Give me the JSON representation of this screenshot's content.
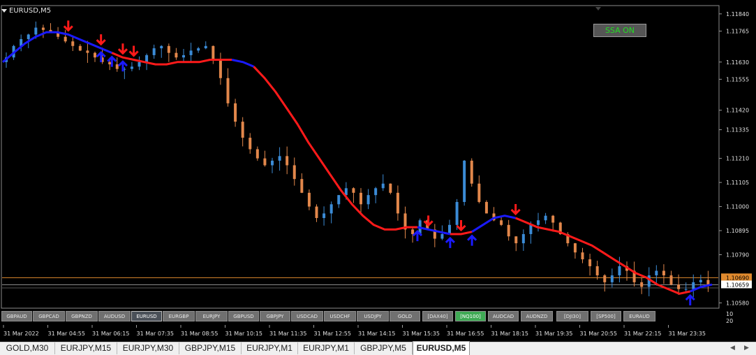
{
  "window": {
    "symbol_title": "EURUSD,M5"
  },
  "ssa_button": {
    "label": "SSA ON"
  },
  "chart_data": {
    "type": "candlestick",
    "symbol": "EURUSD",
    "timeframe": "M5",
    "ylim": [
      1.1056,
      1.1187
    ],
    "y_ticks": [
      "1.11840",
      "1.11765",
      "1.11630",
      "1.11555",
      "1.11420",
      "1.11335",
      "1.11210",
      "1.11105",
      "1.11000",
      "1.10895",
      "1.10790",
      "1.10580"
    ],
    "x_ticks": [
      "31 Mar 2022",
      "31 Mar 04:55",
      "31 Mar 06:15",
      "31 Mar 07:35",
      "31 Mar 08:55",
      "31 Mar 10:15",
      "31 Mar 11:35",
      "31 Mar 12:55",
      "31 Mar 14:15",
      "31 Mar 15:35",
      "31 Mar 16:55",
      "31 Mar 18:15",
      "31 Mar 19:35",
      "31 Mar 20:55",
      "31 Mar 22:15",
      "31 Mar 23:35"
    ],
    "price_labels": {
      "orange": "1.10690",
      "current": "1.10659"
    },
    "orange_line_level": 1.1069,
    "current_price": 1.10659,
    "bottom_scale": [
      "10",
      "20"
    ],
    "closes": [
      1.1165,
      1.117,
      1.1173,
      1.1175,
      1.1178,
      1.1177,
      1.1176,
      1.1174,
      1.1172,
      1.117,
      1.1168,
      1.1167,
      1.1165,
      1.1163,
      1.1162,
      1.116,
      1.116,
      1.1161,
      1.1163,
      1.1166,
      1.1169,
      1.117,
      1.1167,
      1.1165,
      1.1166,
      1.1168,
      1.1169,
      1.117,
      1.1164,
      1.1156,
      1.1145,
      1.1137,
      1.113,
      1.1125,
      1.1121,
      1.1118,
      1.112,
      1.1122,
      1.1118,
      1.1112,
      1.1106,
      1.11,
      1.1095,
      1.1097,
      1.1101,
      1.1105,
      1.1108,
      1.1106,
      1.1101,
      1.1105,
      1.1108,
      1.111,
      1.1106,
      1.1097,
      1.109,
      1.1088,
      1.1094,
      1.109,
      1.1086,
      1.1088,
      1.1092,
      1.1102,
      1.112,
      1.111,
      1.1102,
      1.1097,
      1.1094,
      1.1092,
      1.1087,
      1.1084,
      1.1088,
      1.1092,
      1.1094,
      1.1096,
      1.1093,
      1.1088,
      1.1084,
      1.108,
      1.1077,
      1.1074,
      1.107,
      1.1067,
      1.107,
      1.1074,
      1.1072,
      1.1067,
      1.1065,
      1.107,
      1.1072,
      1.107,
      1.1066,
      1.1064,
      1.1064,
      1.1067,
      1.1068,
      1.1066
    ],
    "ssa_line": [
      1.1163,
      1.1167,
      1.1171,
      1.1174,
      1.1176,
      1.1176,
      1.1175,
      1.1173,
      1.1171,
      1.1169,
      1.1167,
      1.1165,
      1.1164,
      1.1163,
      1.1162,
      1.1162,
      1.1163,
      1.1163,
      1.1163,
      1.1164,
      1.1164,
      1.1164,
      1.1163,
      1.1161,
      1.1156,
      1.115,
      1.1143,
      1.1136,
      1.1128,
      1.1121,
      1.1114,
      1.1107,
      1.1101,
      1.1096,
      1.1092,
      1.109,
      1.109,
      1.1091,
      1.1091,
      1.109,
      1.1089,
      1.1088,
      1.1088,
      1.1089,
      1.1092,
      1.1095,
      1.1096,
      1.1095,
      1.1093,
      1.1091,
      1.109,
      1.1089,
      1.1087,
      1.1085,
      1.1083,
      1.108,
      1.1077,
      1.1074,
      1.1071,
      1.1069,
      1.1066,
      1.1064,
      1.1062,
      1.1063,
      1.1065,
      1.1066
    ],
    "ssa_segments": [
      {
        "from": 0,
        "to": 10,
        "color": "#1a1aff"
      },
      {
        "from": 10,
        "to": 21,
        "color": "#ff1a1a"
      },
      {
        "from": 21,
        "to": 23,
        "color": "#1a1aff"
      },
      {
        "from": 23,
        "to": 38,
        "color": "#ff1a1a"
      },
      {
        "from": 38,
        "to": 41,
        "color": "#1a1aff"
      },
      {
        "from": 41,
        "to": 43,
        "color": "#ff1a1a"
      },
      {
        "from": 43,
        "to": 47,
        "color": "#1a1aff"
      },
      {
        "from": 47,
        "to": 63,
        "color": "#ff1a1a"
      },
      {
        "from": 63,
        "to": 65,
        "color": "#1a1aff"
      }
    ],
    "up_arrows": [
      9,
      10,
      11,
      38,
      41,
      43,
      63
    ],
    "down_arrows": [
      6,
      9,
      11,
      12,
      39,
      42,
      47
    ],
    "colors": {
      "bull": "#3b8bd6",
      "bear": "#e2874b",
      "grid": "#2a2a2a",
      "axis": "#9a9a9a",
      "orange_line": "#e08a2e",
      "current_line": "#8a8a8a"
    }
  },
  "symbol_buttons": [
    {
      "label": "GBPAUD",
      "active": false
    },
    {
      "label": "GBPCAD",
      "active": false
    },
    {
      "label": "GBPNZD",
      "active": false
    },
    {
      "label": "AUDUSD",
      "active": false
    },
    {
      "label": "EURUSD",
      "active": true
    },
    {
      "label": "EURGBP",
      "active": false
    },
    {
      "label": "EURJPY",
      "active": false
    },
    {
      "label": "GBPUSD",
      "active": false
    },
    {
      "label": "GBPJPY",
      "active": false
    },
    {
      "label": "USDCAD",
      "active": false
    },
    {
      "label": "USDCHF",
      "active": false
    },
    {
      "label": "USDJPY",
      "active": false
    },
    {
      "label": "GOLD",
      "active": false
    },
    {
      "label": "[DAX40]",
      "active": false
    },
    {
      "label": "[NQ100]",
      "active": false,
      "highlight": "#3faa55"
    },
    {
      "label": "AUDCAD",
      "active": false
    },
    {
      "label": "AUDNZD",
      "active": false
    },
    {
      "label": "[DJI30]",
      "active": false
    },
    {
      "label": "[SP500]",
      "active": false
    },
    {
      "label": "EURAUD",
      "active": false
    }
  ],
  "tabs": [
    {
      "label": "GOLD,M30",
      "active": false
    },
    {
      "label": "EURJPY,M15",
      "active": false
    },
    {
      "label": "EURJPY,M30",
      "active": false
    },
    {
      "label": "GBPJPY,M15",
      "active": false
    },
    {
      "label": "EURJPY,M1",
      "active": false
    },
    {
      "label": "EURJPY,M1",
      "active": false
    },
    {
      "label": "GBPJPY,M5",
      "active": false
    },
    {
      "label": "EURUSD,M5",
      "active": true
    }
  ]
}
